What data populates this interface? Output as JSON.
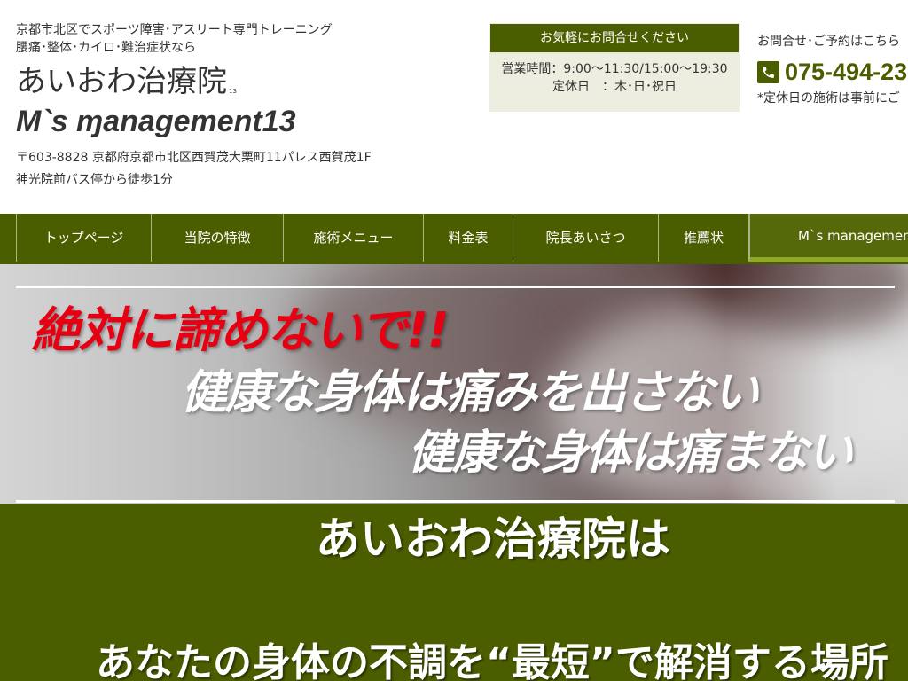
{
  "header": {
    "tagline_line1": "京都市北区でスポーツ障害･アスリート専門トレーニング",
    "tagline_line2": "腰痛･整体･カイロ･難治症状なら",
    "site_name": "あいおわ治療院",
    "site_name_sup": "13",
    "sub_brand": "M`s  ɱanagement13",
    "address_line1": "〒603-8828 京都府京都市北区西賀茂大栗町11パレス西賀茂1F",
    "address_line2": "神光院前バス停から徒歩1分"
  },
  "contact_box": {
    "heading": "お気軽にお問合せください",
    "hours": "営業時間：9:00〜11:30/15:00〜19:30",
    "closed": "定休日　：木･日･祝日"
  },
  "tel": {
    "lead": "お問合せ･ご予約はこちら",
    "number": "075-494-23",
    "note": "*定休日の施術は事前にご",
    "icon": "phone-icon",
    "color": "#4a5e00"
  },
  "nav": {
    "items": [
      {
        "label": "トップページ"
      },
      {
        "label": "当院の特徴"
      },
      {
        "label": "施術メニュー"
      },
      {
        "label": "料金表"
      },
      {
        "label": "院長あいさつ"
      },
      {
        "label": "推薦状"
      },
      {
        "label": "M`s management"
      }
    ],
    "active_index": 6
  },
  "hero": {
    "headline_red": "絶対に諦めないで!!",
    "line1": "健康な身体は痛みを出さない",
    "line2": "健康な身体は痛まない",
    "accent_color": "#e60012"
  },
  "intro": {
    "title": "あいおわ治療院は",
    "subtitle": "あなたの身体の不調を“最短”で解消する場所"
  },
  "colors": {
    "brand_green": "#4a5e00",
    "nav_active_bar": "#8fa82a",
    "contact_bg": "#eeeee0"
  }
}
